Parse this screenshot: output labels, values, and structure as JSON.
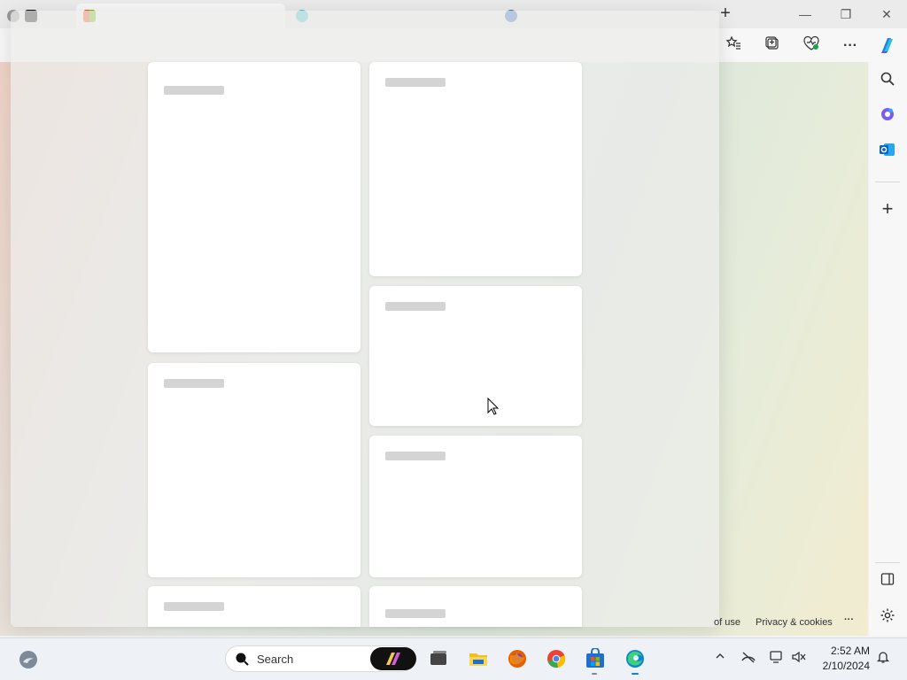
{
  "browser": {
    "new_tab_symbol": "+",
    "window_controls": {
      "minimize": "—",
      "restore": "❐",
      "close": "✕"
    },
    "toolbar_icons": [
      "favorites-icon",
      "collections-icon",
      "browser-essentials-icon",
      "more-icon",
      "copilot-icon"
    ],
    "more_label": "···"
  },
  "sidebar": {
    "icons": [
      "search-icon",
      "copilot-apps-icon",
      "outlook-icon",
      "add-icon",
      "panel-icon",
      "settings-icon"
    ],
    "add_symbol": "+"
  },
  "footer": {
    "terms_text": "of use",
    "privacy_text": "Privacy & cookies",
    "more_text": "···"
  },
  "taskbar": {
    "search_label": "Search",
    "time": "2:52 AM",
    "date": "2/10/2024",
    "tray_chevron": "^",
    "colors": {
      "explorer": "#f2c01e",
      "firefox": "#e66000",
      "chrome": "#34a853",
      "store": "#1f6fd1",
      "edge": "#0c83d6"
    }
  },
  "accent_colors": {
    "copilot": "#2f76e8",
    "outlook": "#0a64c9",
    "tab_ms": "#f25022"
  }
}
